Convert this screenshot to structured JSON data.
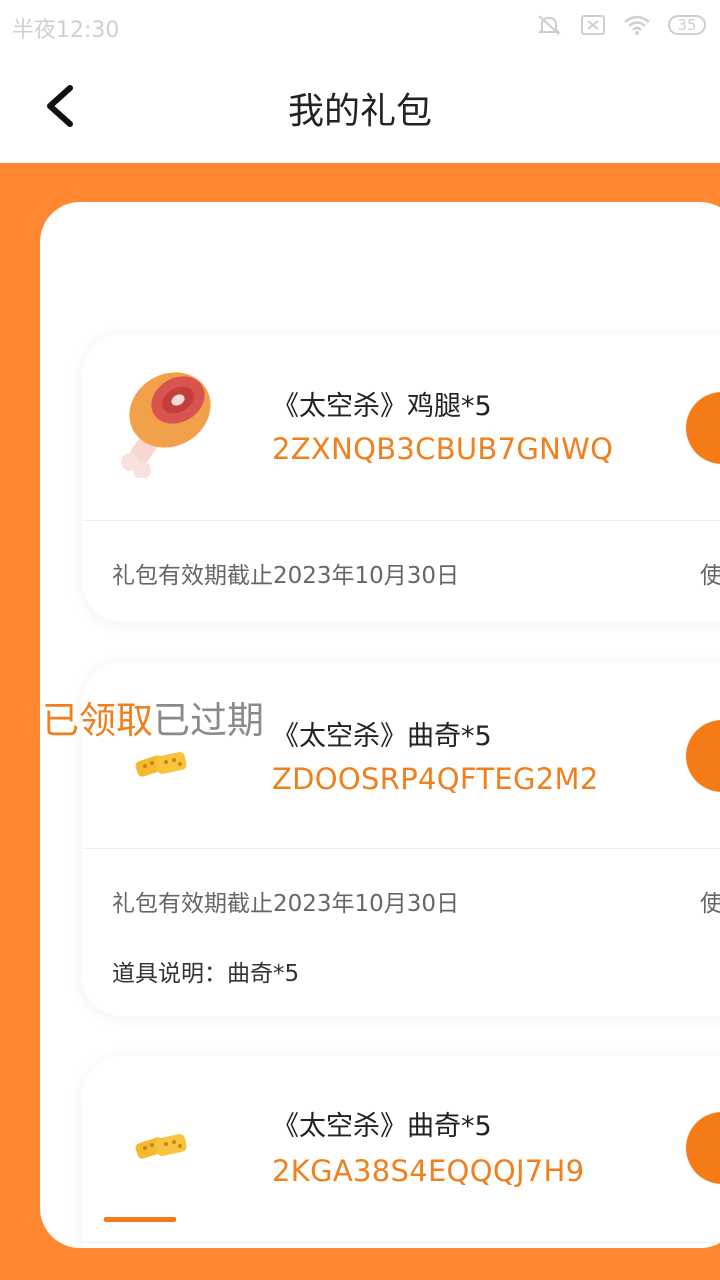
{
  "status_bar": {
    "time": "半夜12:30",
    "battery": "35"
  },
  "header": {
    "title": "我的礼包"
  },
  "tabs": {
    "claimed": "已领取",
    "expired": "已过期"
  },
  "gifts": [
    {
      "name": "《太空杀》鸡腿*5",
      "code": "2ZXNQB3CBUB7GNWQ",
      "expiry": "礼包有效期截止2023年10月30日",
      "use_label": "使",
      "icon": "drumstick-icon"
    },
    {
      "name": "《太空杀》曲奇*5",
      "code": "ZDOOSRP4QFTEG2M2",
      "expiry": "礼包有效期截止2023年10月30日",
      "use_label": "使",
      "description": "道具说明：曲奇*5",
      "icon": "cookie-icon"
    },
    {
      "name": "《太空杀》曲奇*5",
      "code": "2KGA38S4EQQQJ7H9",
      "icon": "cookie-icon"
    }
  ],
  "colors": {
    "accent": "#ff8732",
    "code_text": "#f07f1e"
  }
}
